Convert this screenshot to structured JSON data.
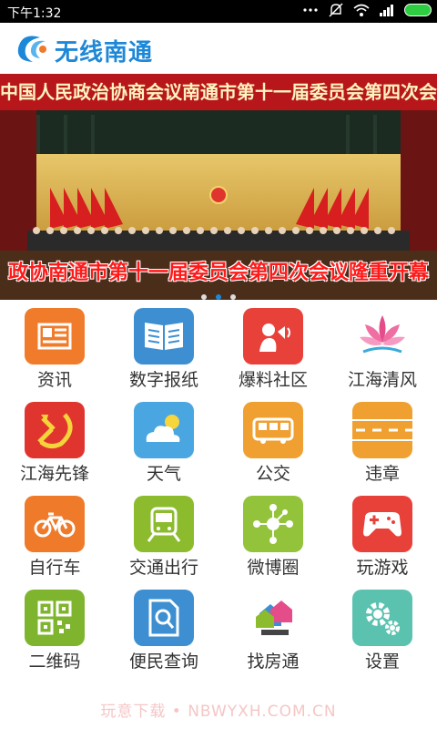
{
  "status_bar": {
    "time": "下午1:32"
  },
  "app": {
    "name": "无线南通",
    "brand_color": "#1e88d8"
  },
  "banner": {
    "top_text": "中国人民政治协商会议南通市第十一届委员会第四次会议",
    "caption": "政协南通市第十一届委员会第四次会议隆重开幕",
    "active_dot": 1,
    "dot_count": 3
  },
  "grid": [
    {
      "label": "资讯",
      "icon": "news-icon",
      "color": "#f07b2a"
    },
    {
      "label": "数字报纸",
      "icon": "book-icon",
      "color": "#3d8fd1"
    },
    {
      "label": "爆料社区",
      "icon": "person-speaker-icon",
      "color": "#e8413a"
    },
    {
      "label": "江海清风",
      "icon": "lotus-icon",
      "color": "#ffffff"
    },
    {
      "label": "江海先锋",
      "icon": "hammer-sickle-icon",
      "color": "#e0352e"
    },
    {
      "label": "天气",
      "icon": "weather-icon",
      "color": "#4aa6e0"
    },
    {
      "label": "公交",
      "icon": "bus-icon",
      "color": "#f0a030"
    },
    {
      "label": "违章",
      "icon": "road-icon",
      "color": "#f0a030"
    },
    {
      "label": "自行车",
      "icon": "bicycle-icon",
      "color": "#ef7a2a"
    },
    {
      "label": "交通出行",
      "icon": "transit-icon",
      "color": "#8cbc2e"
    },
    {
      "label": "微博圈",
      "icon": "network-icon",
      "color": "#93c33a"
    },
    {
      "label": "玩游戏",
      "icon": "gamepad-icon",
      "color": "#e8413a"
    },
    {
      "label": "二维码",
      "icon": "qrcode-icon",
      "color": "#7fb52e"
    },
    {
      "label": "便民查询",
      "icon": "search-doc-icon",
      "color": "#3d8fd1"
    },
    {
      "label": "找房通",
      "icon": "house-icon",
      "color": "#ffffff"
    },
    {
      "label": "设置",
      "icon": "gear-icon",
      "color": "#5bc2b0"
    }
  ],
  "watermark": "玩意下载 • NBWYXH.COM.CN"
}
